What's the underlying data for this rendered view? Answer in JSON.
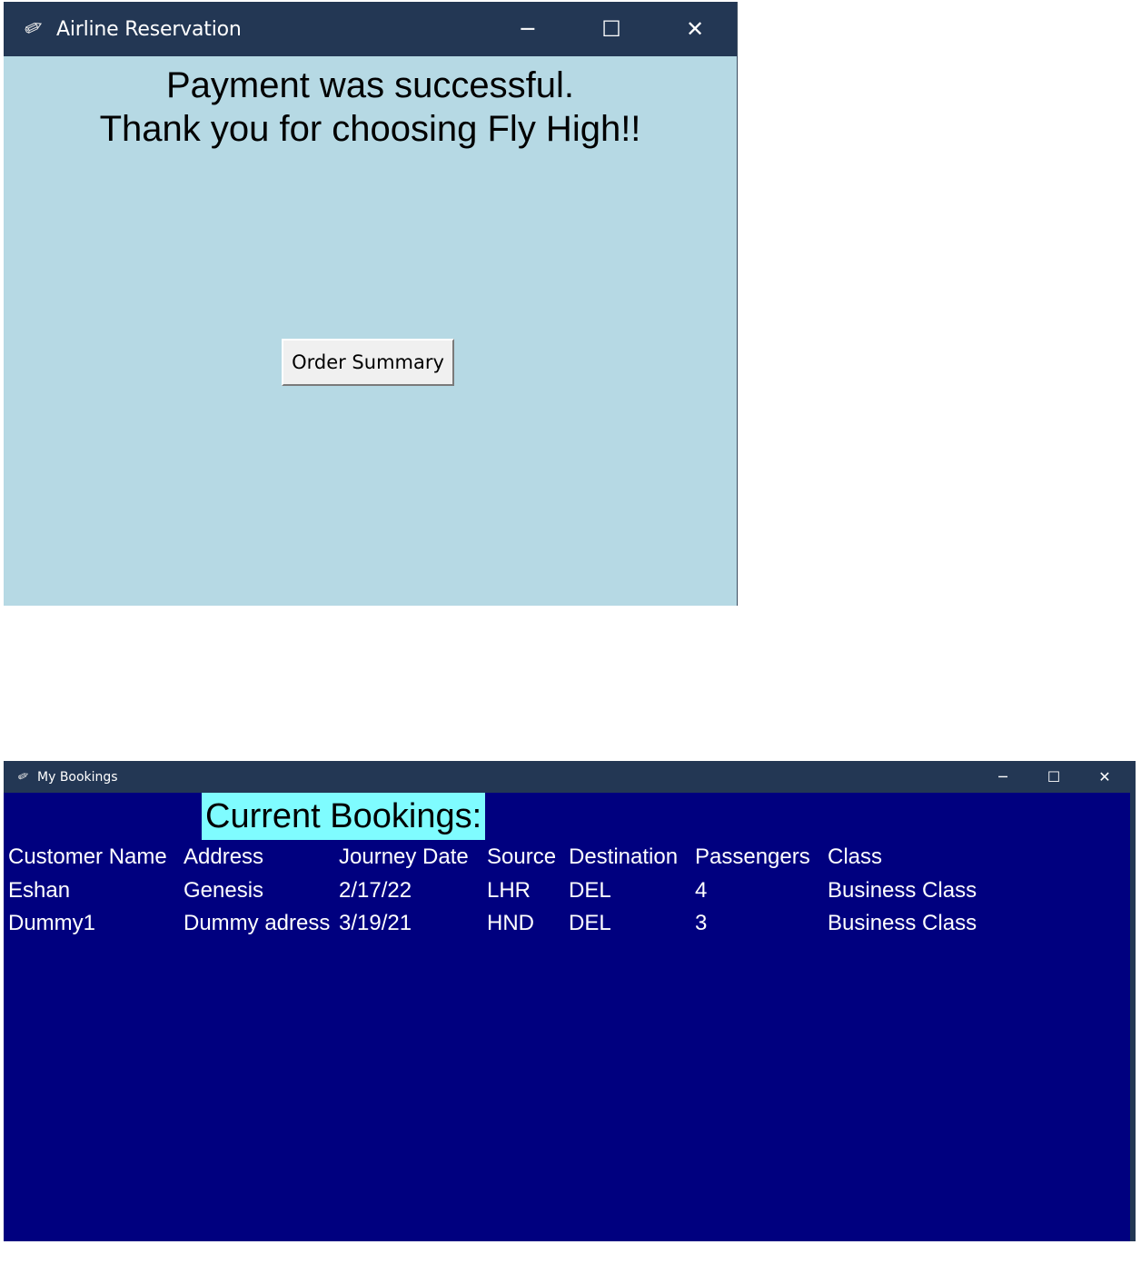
{
  "reservation_window": {
    "title": "Airline Reservation",
    "icon": "feather-icon",
    "controls": {
      "minimize": "─",
      "maximize": "☐",
      "close": "✕"
    },
    "message_line1": "Payment was successful.",
    "message_line2": "Thank you for choosing Fly High!!",
    "order_summary_button": "Order Summary",
    "background_color": "#b6d9e4",
    "titlebar_color": "#233754"
  },
  "bookings_window": {
    "title": "My Bookings",
    "icon": "feather-icon",
    "controls": {
      "minimize": "─",
      "maximize": "☐",
      "close": "✕"
    },
    "heading": "Current Bookings:",
    "heading_color": "#7ffcff",
    "background_color": "#00007f",
    "columns": [
      "Customer Name",
      "Address",
      "Journey Date",
      "Source",
      "Destination",
      "Passengers",
      "Class"
    ],
    "rows": [
      [
        "Eshan",
        "Genesis",
        "2/17/22",
        "LHR",
        "DEL",
        "4",
        "Business Class"
      ],
      [
        "Dummy1",
        "Dummy adress",
        "3/19/21",
        "HND",
        "DEL",
        "3",
        "Business Class"
      ]
    ]
  }
}
